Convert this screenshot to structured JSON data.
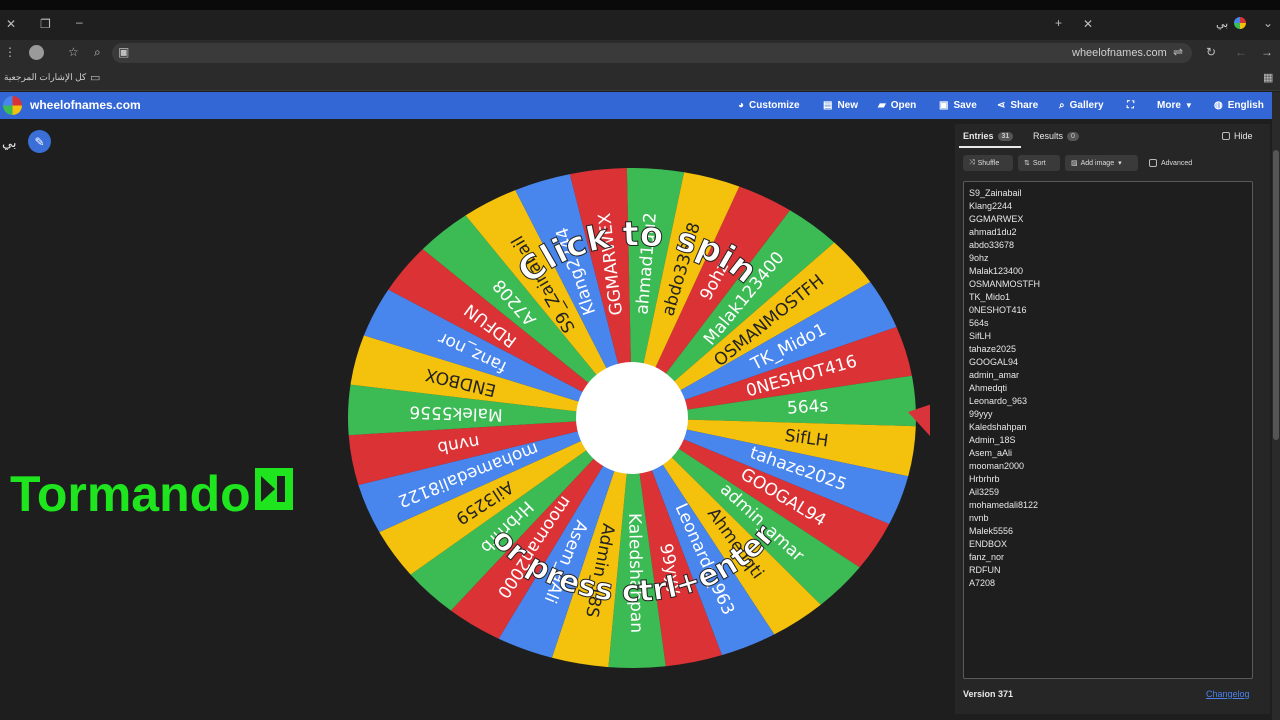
{
  "browser": {
    "url": "wheelofnames.com",
    "tab_title": "بي",
    "bookmarks_label": "كل الإشارات المرجعية"
  },
  "app": {
    "logo_text": "wheelofnames.com",
    "nav": {
      "customize": "Customize",
      "new": "New",
      "open": "Open",
      "save": "Save",
      "share": "Share",
      "gallery": "Gallery",
      "more": "More",
      "language": "English"
    }
  },
  "wheel": {
    "title": "بي",
    "center_top_text": "Click to spin",
    "center_bottom_text": "or press ctrl+enter",
    "colors": [
      "#db3236",
      "#3cba54",
      "#f4c20d",
      "#4885ed"
    ],
    "segments": [
      "9ohz",
      "Malak123400",
      "OSMANMOSTFH",
      "TK_Mido1",
      "0NESHOT416",
      "564s",
      "SifLH",
      "tahaze2025",
      "GOOGAL94",
      "admin_amar",
      "Ahmedqti",
      "Leonardo_963",
      "99yyy",
      "Kaledshahpan",
      "Admin_18S",
      "Asem_aAli",
      "mooman2000",
      "Hrbrhrb",
      "Ail3259",
      "mohamedali8122",
      "nvnb",
      "Malek5556",
      "ENDBOX",
      "fanz_nor",
      "RDFUN",
      "A7208",
      "S9_Zainabail",
      "Klang2244",
      "GGMARWEX",
      "ahmad1du2",
      "abdo33678"
    ]
  },
  "sidebar": {
    "tab_entries": "Entries",
    "entries_count": "31",
    "tab_results": "Results",
    "results_count": "0",
    "hide_label": "Hide",
    "shuffle_label": "Shuffle",
    "sort_label": "Sort",
    "add_image_label": "Add image",
    "advanced_label": "Advanced",
    "entries": [
      "S9_Zainabail",
      "Klang2244",
      "GGMARWEX",
      "ahmad1du2",
      "abdo33678",
      "9ohz",
      "Malak123400",
      "OSMANMOSTFH",
      "TK_Mido1",
      "0NESHOT416",
      "564s",
      "SifLH",
      "tahaze2025",
      "GOOGAL94",
      "admin_amar",
      "Ahmedqti",
      "Leonardo_963",
      "99yyy",
      "Kaledshahpan",
      "Admin_18S",
      "Asem_aAli",
      "mooman2000",
      "Hrbrhrb",
      "Ail3259",
      "mohamedali8122",
      "nvnb",
      "Malek5556",
      "ENDBOX",
      "fanz_nor",
      "RDFUN",
      "A7208"
    ],
    "version": "Version 371",
    "changelog": "Changelog"
  },
  "overlay": {
    "text": "Tormando",
    "color": "#1ee51e"
  }
}
